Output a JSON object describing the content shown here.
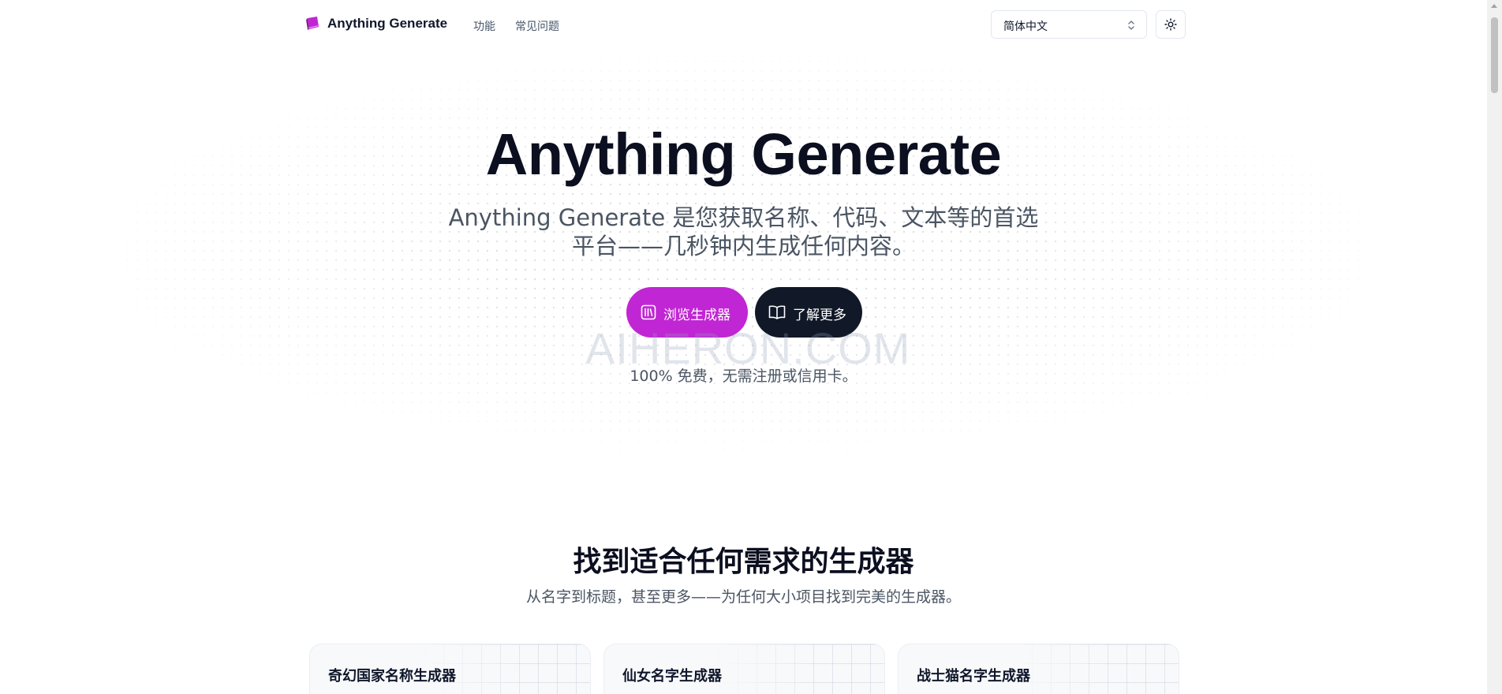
{
  "header": {
    "brand": "Anything Generate",
    "nav": [
      "功能",
      "常见问题"
    ],
    "language": "简体中文"
  },
  "hero": {
    "title": "Anything Generate",
    "subtitle": "Anything Generate 是您获取名称、代码、文本等的首选平台——几秒钟内生成任何内容。",
    "primary_button": "浏览生成器",
    "secondary_button": "了解更多",
    "note": "100% 免费，无需注册或信用卡。",
    "watermark": "AIHERON.COM"
  },
  "section": {
    "title": "找到适合任何需求的生成器",
    "subtitle": "从名字到标题，甚至更多——为任何大小项目找到完美的生成器。",
    "cards": [
      {
        "title": "奇幻国家名称生成器"
      },
      {
        "title": "仙女名字生成器"
      },
      {
        "title": "战士猫名字生成器"
      }
    ]
  },
  "colors": {
    "accent": "#c026d3",
    "dark": "#111827",
    "text": "#0b0f1f",
    "muted": "#4b5563"
  },
  "icons": [
    "book-logo-icon",
    "chevrons-up-down-icon",
    "sun-icon",
    "library-icon",
    "open-book-icon"
  ]
}
